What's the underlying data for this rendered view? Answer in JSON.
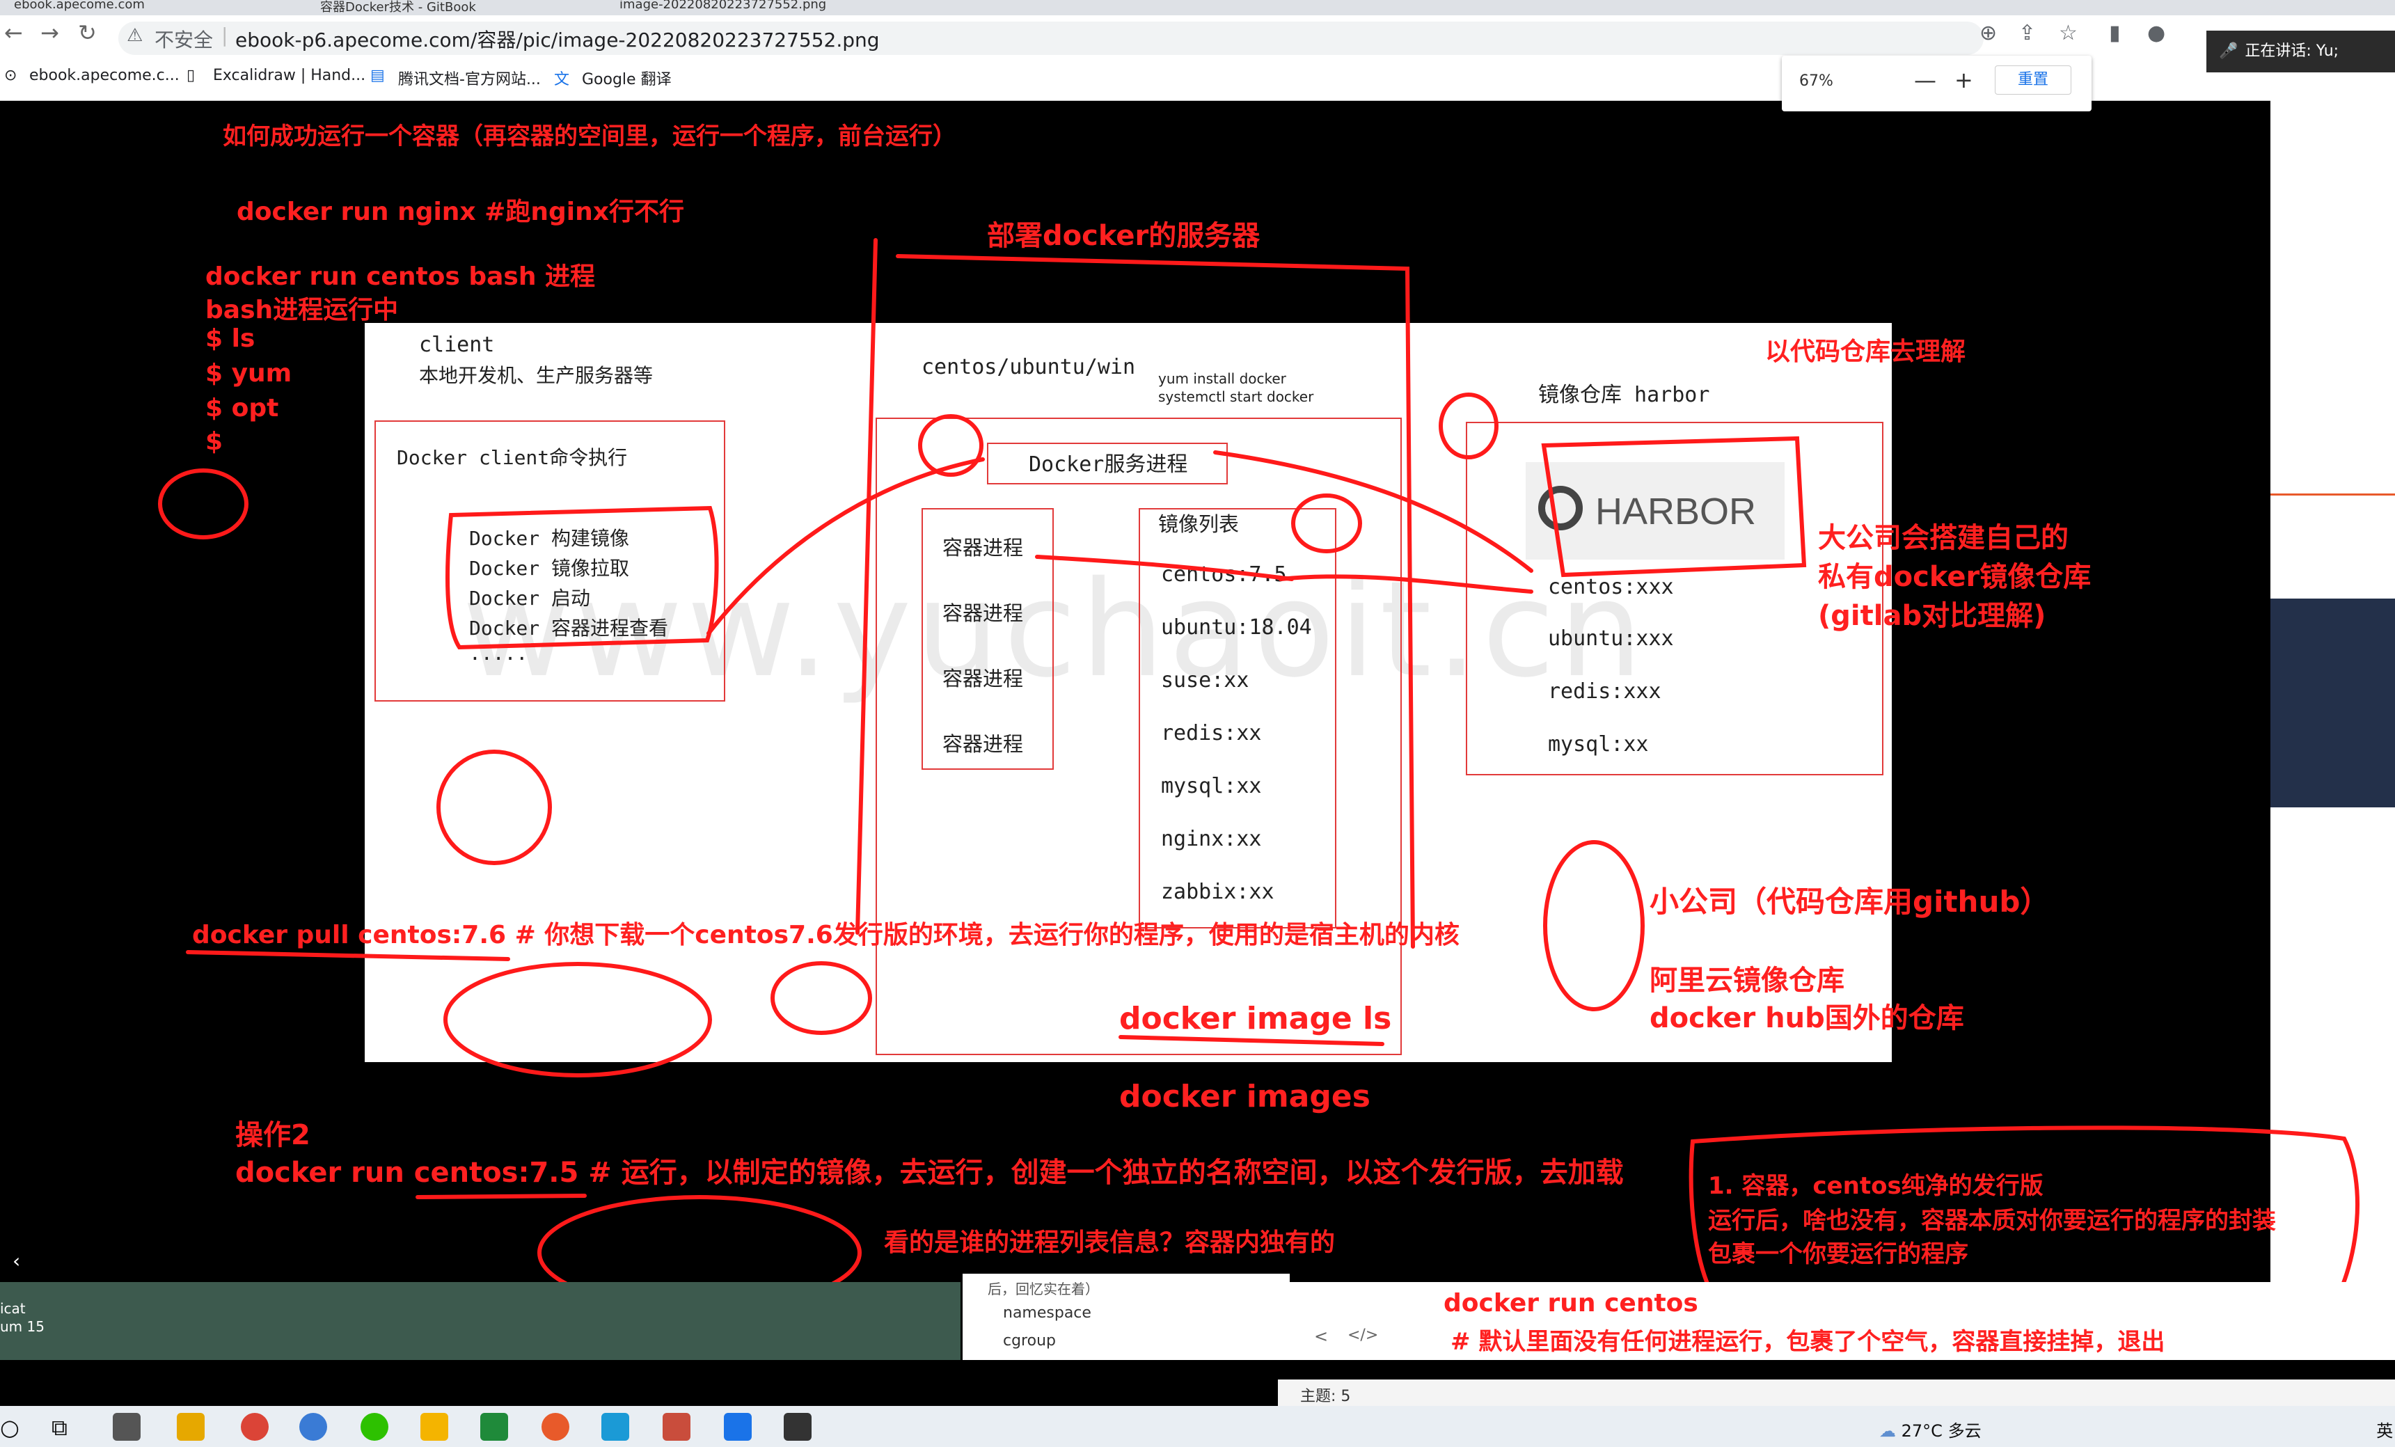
{
  "browser": {
    "tabs": [
      "ebook.apecome.com",
      "容器Docker技术 - GitBook",
      "image-20220820223727552.png"
    ],
    "not_secure": "不安全",
    "url": "ebook-p6.apecome.com/容器/pic/image-20220820223727552.png",
    "bookmarks": [
      "ebook.apecome.c...",
      "Excalidraw | Hand...",
      "腾讯文档-官方网站...",
      "Google 翻译"
    ],
    "zoom": {
      "value": "67%",
      "minus": "—",
      "plus": "+",
      "reset": "重置"
    },
    "speaking": "正在讲话: Yu;"
  },
  "annotations": {
    "title": "如何成功运行一个容器（再容器的空间里，运行一个程序，前台运行）",
    "run_nginx": "docker run nginx #跑nginx行不行",
    "run_bash": "docker run  centos  bash 进程",
    "bash_running": "bash进程运行中",
    "shell_lines": [
      "$  ls",
      "$  yum",
      "$  opt",
      "$"
    ],
    "server_label": "部署docker的服务器",
    "repo_hint": "以代码仓库去理解",
    "big_company": [
      "大公司会搭建自己的",
      "私有docker镜像仓库",
      "(gitlab对比理解)"
    ],
    "small_company": "小公司（代码仓库用github）",
    "aliyun": "阿里云镜像仓库",
    "dockerhub": "docker hub国外的仓库",
    "pull": "docker pull centos:7.6  # 你想下载一个centos7.6发行版的环境，去运行你的程序，使用的是宿主机的内核",
    "image_ls": "docker  image ls",
    "images": "docker images",
    "op2": "操作2",
    "run_centos": "docker  run  centos:7.5 # 运行，以制定的镜像，去运行，创建一个独立的名称空间，以这个发行版，去加载",
    "ps_question": "看的是谁的进程列表信息？容器内独有的",
    "container_note": [
      "1. 容器，centos纯净的发行版",
      "运行后，啥也没有，容器本质对你要运行的程序的封装",
      "包裹一个你要运行的程序"
    ],
    "run_centos2": "docker run centos",
    "run_centos2_note": "# 默认里面没有任何进程运行，包裹了个空气，容器直接挂掉，退出"
  },
  "diagram": {
    "client_title": "client",
    "client_sub": "本地开发机、生产服务器等",
    "client_box_title": "Docker client命令执行",
    "client_cmds": [
      "Docker 构建镜像",
      "Docker 镜像拉取",
      "Docker 启动",
      "Docker 容器进程查看",
      "....."
    ],
    "host_os": "centos/ubuntu/win",
    "install_cmds": [
      "yum install docker",
      "systemctl start docker"
    ],
    "docker_service": "Docker服务进程",
    "containers": [
      "容器进程",
      "容器进程",
      "容器进程",
      "容器进程"
    ],
    "images_title": "镜像列表",
    "images": [
      "centos:7.5",
      "ubuntu:18.04",
      "suse:xx",
      "redis:xx",
      "mysql:xx",
      "nginx:xx",
      "zabbix:xx"
    ],
    "registry_title": "镜像仓库 harbor",
    "harbor_logo": "HARBOR",
    "registry_images": [
      "centos:xxx",
      "ubuntu:xxx",
      "redis:xxx",
      "mysql:xx"
    ],
    "watermark": "www.yuchaoit.cn"
  },
  "bottom": {
    "side_items": [
      "namespace",
      "cgroup"
    ],
    "side_header": "后，回忆实在着）",
    "theme": "主题: 5",
    "editor_nav": [
      "<",
      "</>"
    ],
    "left_app": [
      "icat",
      "um 15"
    ],
    "tray": {
      "weather": "27°C 多云",
      "lang": "英"
    }
  }
}
